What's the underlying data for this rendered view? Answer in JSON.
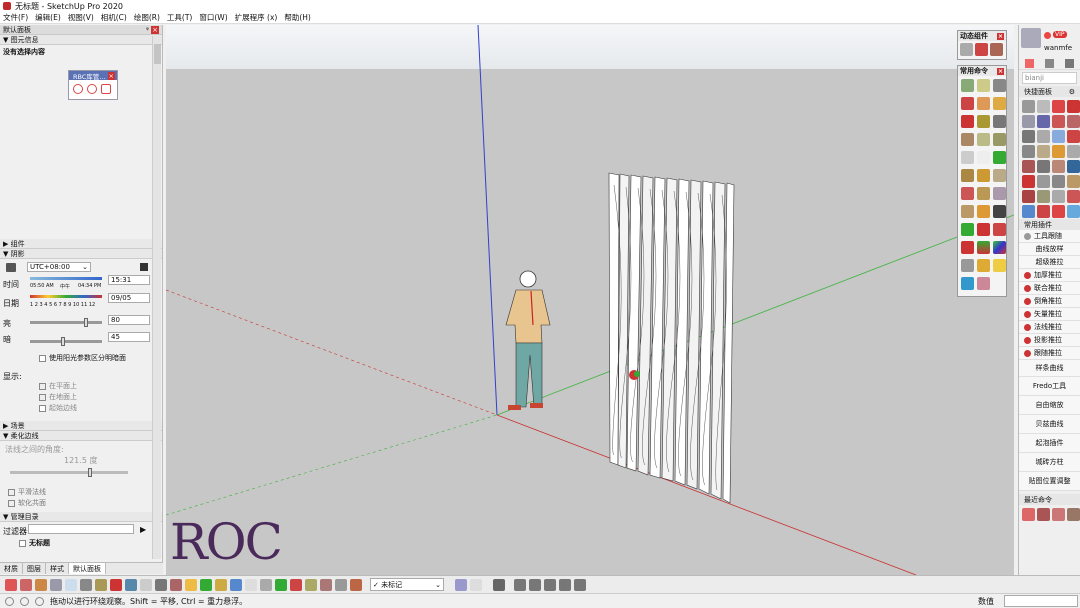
{
  "window": {
    "title": "无标题 - SketchUp Pro 2020"
  },
  "menu": [
    "文件(F)",
    "编辑(E)",
    "视图(V)",
    "相机(C)",
    "绘图(R)",
    "工具(T)",
    "窗口(W)",
    "扩展程序 (x)",
    "帮助(H)"
  ],
  "left_panel": {
    "title": "默认面板",
    "entity_info": {
      "header": "图元信息",
      "empty_text": "没有选择内容"
    },
    "rbc": {
      "title": "RBC库管..."
    },
    "components": {
      "header": "组件"
    },
    "shadows": {
      "header": "阴影",
      "timezone": "UTC+08:00",
      "time_label": "时间",
      "time_start": "05:50 AM",
      "time_mid": "中午",
      "time_end": "04:34 PM",
      "time_value": "15:31",
      "date_label": "日期",
      "months": "1 2 3 4 5 6 7 8 9 10 11 12",
      "date_value": "09/05",
      "light_label": "亮",
      "light_value": "80",
      "light_level": 80,
      "dark_label": "暗",
      "dark_value": "45",
      "dark_level": 45,
      "use_sun": "使用阳光参数区分明暗面",
      "display_label": "显示:",
      "on_faces": "在平面上",
      "on_ground": "在地面上",
      "from_edges": "起始边线"
    },
    "scenes": {
      "header": "场景"
    },
    "soften": {
      "header": "柔化边线",
      "angle_label": "法线之间的角度:",
      "angle_value": "121.5",
      "angle_unit": "度",
      "smooth_normals": "平滑法线",
      "soften_coplanar": "软化共面"
    },
    "outliner": {
      "header": "管理目录",
      "filter_label": "过滤器:",
      "model_name": "无标题"
    },
    "tabs": [
      "材质",
      "图层",
      "样式",
      "默认面板"
    ]
  },
  "floating": {
    "dynamic_title": "动态组件",
    "common_title": "常用命令"
  },
  "right_panel": {
    "username": "wanmfe",
    "vip": "VIP",
    "search": "bianji",
    "quick_title": "快捷面板",
    "plugins_title": "常用插件",
    "plugins": [
      "工具跟随",
      "曲线放样",
      "超级推拉",
      "加厚推拉",
      "联合推拉",
      "倒角推拉",
      "矢量推拉",
      "法线推拉",
      "投影推拉",
      "跟随推拉",
      "样条曲线",
      "Fredo工具",
      "自由缩放",
      "贝兹曲线",
      "起泡插件",
      "城砖方柱",
      "贴图位置调整"
    ],
    "plugin_markers": [
      false,
      false,
      false,
      true,
      true,
      true,
      true,
      true,
      true,
      true,
      false,
      false,
      false,
      false,
      false,
      false,
      false
    ],
    "recent_title": "最近命令"
  },
  "bottom_toolbar": {
    "tag_label": "未标记"
  },
  "status": {
    "message": "拖动以进行环绕观察。Shift = 平移, Ctrl = 重力悬浮。",
    "measure_label": "数值"
  },
  "watermark": {
    "text": "ROC"
  }
}
